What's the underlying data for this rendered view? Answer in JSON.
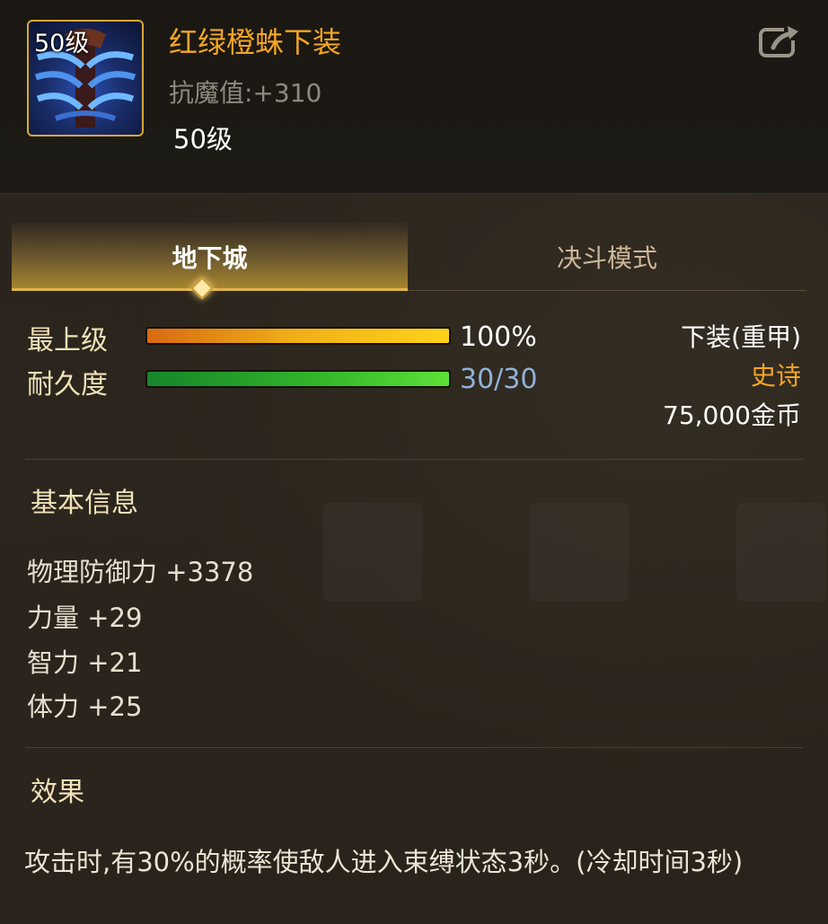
{
  "item": {
    "level_badge": "50级",
    "name": "红绿橙蛛下装",
    "resist": "抗魔值:+310",
    "level": "50级"
  },
  "tabs": [
    {
      "label": "地下城",
      "active": true
    },
    {
      "label": "决斗模式",
      "active": false
    }
  ],
  "stats": {
    "grade": {
      "label": "最上级",
      "value_text": "100%",
      "fill": 1.0
    },
    "durability": {
      "label": "耐久度",
      "value_text": "30/30",
      "fill": 1.0
    }
  },
  "meta": {
    "type": "下装(重甲)",
    "rarity": "史诗",
    "price": "75,000金币"
  },
  "basic_info": {
    "title": "基本信息",
    "attributes": [
      "物理防御力 +3378",
      "力量 +29",
      "智力 +21",
      "体力 +25"
    ]
  },
  "effect": {
    "title": "效果",
    "text": "攻击时,有30%的概率使敌人进入束缚状态3秒。(冷却时间3秒)"
  },
  "colors": {
    "name": "#f5a623",
    "rarity": "#f5a623",
    "durability_value": "#8fb3d9",
    "accent_gold": "#e0b44a"
  },
  "icons": {
    "share": "share-icon",
    "item": "armor-legs-icon"
  }
}
